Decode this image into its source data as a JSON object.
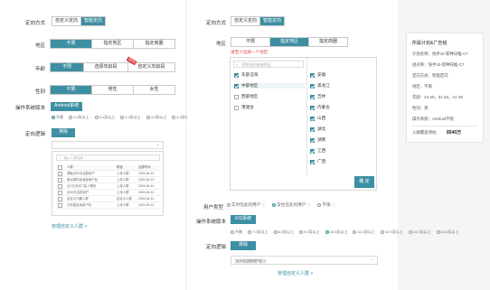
{
  "left": {
    "targeting_label": "定向方式",
    "targeting_options": [
      "自定义定向",
      "智能定向"
    ],
    "region_label": "地区",
    "region_options": [
      "不限",
      "指定地区",
      "指定商圈"
    ],
    "age_label": "年龄",
    "age_options": [
      "不限",
      "选择年龄段",
      "自定义年龄段"
    ],
    "age_badge": "NEW",
    "gender_label": "性别",
    "gender_options": [
      "不限",
      "男性",
      "女性"
    ],
    "os_label": "操作系统版本",
    "os_value": "Android系统",
    "os_versions": [
      "不限",
      "4.0及以上",
      "4.1及以上",
      "4.2及以上",
      "4.3及以上",
      "4.4及以上",
      "5.0及以上",
      "5.1及以上",
      "6.0及以上",
      "7.0及以上"
    ],
    "logic_label": "定向逻辑",
    "logic_value": "排除",
    "search_placeholder": "输入人群名称",
    "table_headers": [
      "人群",
      "覆盖",
      "创建时间"
    ],
    "table_rows": [
      [
        "提取近30天活跃用户",
        "上传人群",
        "2020-06-10"
      ],
      [
        "重点城市高消费用户包",
        "上传人群",
        "2020-06-10"
      ],
      [
        "近7日访问门店人群包",
        "上传人群",
        "2020-06-10"
      ],
      [
        "近30天活跃用户",
        "上传人群",
        "2020-06-10"
      ],
      [
        "自定义兴趣人群",
        "自定义人群",
        "2020-06-10"
      ],
      [
        "已安装应用用户包",
        "上传人群",
        "2020-06-10"
      ]
    ],
    "manage_link": "管理自定义人群 >"
  },
  "right": {
    "targeting_label": "定向方式",
    "targeting_options": [
      "自定义定向",
      "智能定向"
    ],
    "region_label": "地区",
    "region_options": [
      "不限",
      "指定地区",
      "指定商圈"
    ],
    "region_hint": "请至少选择一个地区",
    "region_search_placeholder": "搜索省份或者地区",
    "regions_left": [
      {
        "name": "东部沿海",
        "checked": true
      },
      {
        "name": "中部地区",
        "checked": true
      },
      {
        "name": "西部地区",
        "checked": false
      },
      {
        "name": "港澳台",
        "checked": false
      }
    ],
    "regions_right": [
      {
        "name": "安徽",
        "checked": true
      },
      {
        "name": "黑龙江",
        "checked": true
      },
      {
        "name": "吉林",
        "checked": true
      },
      {
        "name": "内蒙古",
        "checked": true
      },
      {
        "name": "山西",
        "checked": true
      },
      {
        "name": "湖北",
        "checked": true
      },
      {
        "name": "湖南",
        "checked": true
      },
      {
        "name": "江西",
        "checked": true
      },
      {
        "name": "广西",
        "checked": true
      }
    ],
    "confirm_label": "确 定",
    "user_type_label": "用户类型",
    "user_type_options": [
      {
        "label": "实时在此的用户",
        "selected": false
      },
      {
        "label": "常住在此的用户",
        "selected": true
      },
      {
        "label": "不限",
        "selected": false
      }
    ],
    "os_label": "操作系统版本",
    "os_value": "iOS系统",
    "os_versions": [
      "不限",
      "7.0及以上",
      "8.0及以上",
      "9.0及以上",
      "10.0及以上",
      "11.0及以上",
      "12.0及以上",
      "13.0及以上",
      "14.0及以上"
    ],
    "logic_label": "定向逻辑",
    "logic_value": "排除",
    "selected_tag": "近30日活跃用户包 ×",
    "manage_link": "管理自定义人群 >"
  },
  "summary": {
    "title": "所属计划&广告组",
    "lines": [
      "计划名称：快手10-新种日推-C7",
      "组名称：快手10-新种日推-C7",
      "定向方式：智能定向",
      "地区：不限",
      "年龄：24-30，31-40，41-49",
      "性别：男",
      "操作系统：Android不限"
    ],
    "coverage_label": "人群覆盖预估：",
    "coverage_value": "8540万"
  },
  "colors": {
    "accent": "#3d8fa3"
  }
}
